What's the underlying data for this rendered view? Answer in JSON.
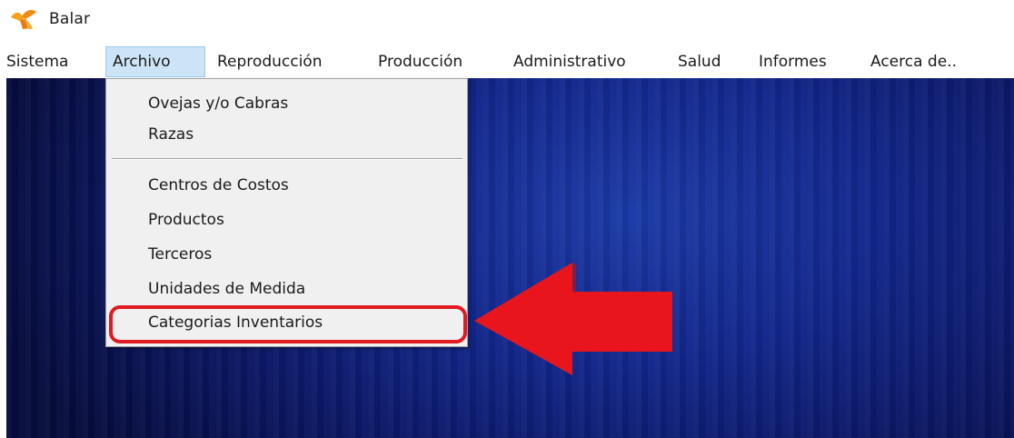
{
  "window": {
    "title": "Balar",
    "icon": "balar-app-icon"
  },
  "menubar": {
    "items": [
      {
        "label": "Sistema"
      },
      {
        "label": "Archivo"
      },
      {
        "label": "Reproducción"
      },
      {
        "label": "Producción"
      },
      {
        "label": "Administrativo"
      },
      {
        "label": "Salud"
      },
      {
        "label": "Informes"
      },
      {
        "label": "Acerca de.."
      }
    ],
    "active_menu": "Archivo"
  },
  "archivo_menu": {
    "items": [
      {
        "label": "Ovejas y/o Cabras"
      },
      {
        "label": "Razas"
      },
      {
        "label": "Centros de Costos"
      },
      {
        "label": "Productos"
      },
      {
        "label": "Terceros"
      },
      {
        "label": "Unidades de Medida"
      },
      {
        "label": "Categorias Inventarios"
      }
    ]
  },
  "annotation": {
    "highlighted_item": "Categorias Inventarios",
    "color": "#e01b22"
  },
  "colors": {
    "menu_active_bg": "#cce4f7",
    "menu_active_border": "#99c9ef",
    "dropdown_bg": "#f0f0f0",
    "desktop_bg": "#12268a"
  }
}
